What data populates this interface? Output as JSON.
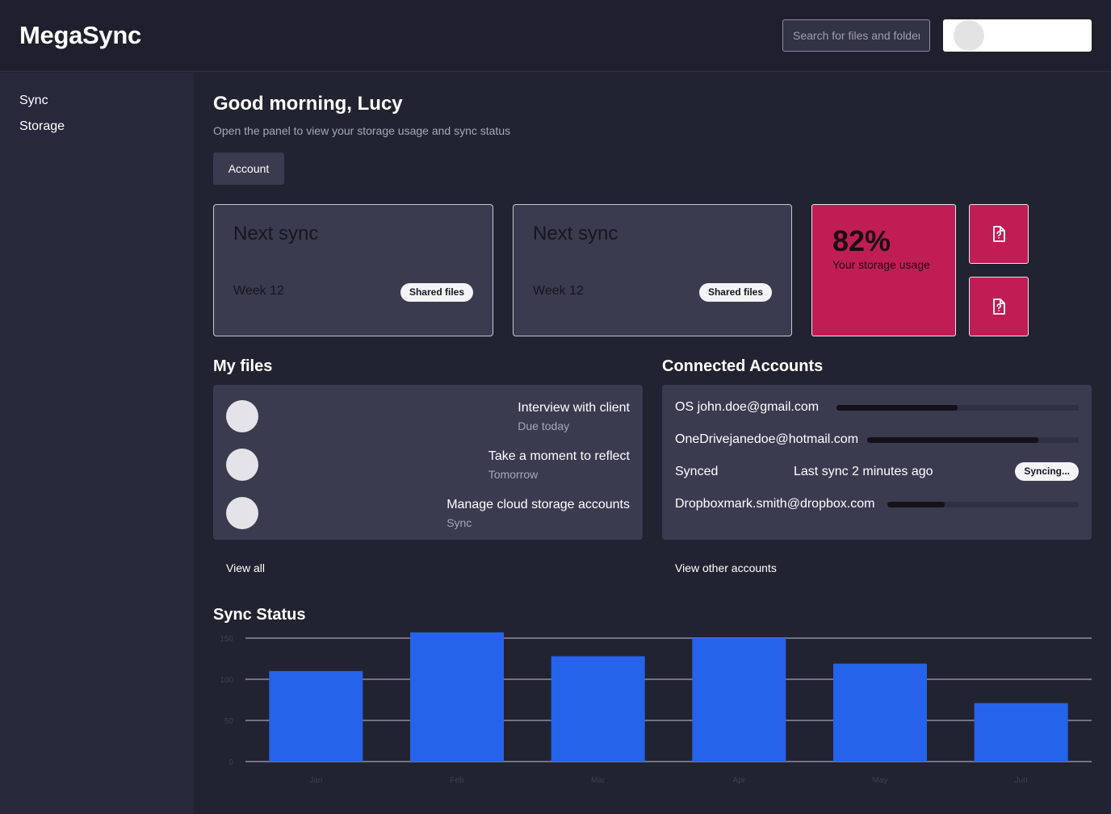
{
  "app": {
    "name": "MegaSync",
    "search_placeholder": "Search for files and folders"
  },
  "sidebar": {
    "items": [
      {
        "label": "Sync"
      },
      {
        "label": "Storage"
      }
    ]
  },
  "main": {
    "greeting": "Good morning, Lucy",
    "subtitle": "Open the panel to view your storage usage and sync status",
    "account_button": "Account"
  },
  "cards": [
    {
      "title": "Next sync",
      "week": "Week 12",
      "badge": "Shared files"
    },
    {
      "title": "Next sync",
      "week": "Week 12",
      "badge": "Shared files"
    }
  ],
  "storage": {
    "percent": "82%",
    "label": "Your storage usage",
    "accent_color": "#c11d55"
  },
  "quick_actions": [
    {
      "icon": "file-question-icon"
    },
    {
      "icon": "file-question-icon"
    }
  ],
  "my_files": {
    "title": "My files",
    "items": [
      {
        "title": "Interview with client",
        "sub": "Due today"
      },
      {
        "title": "Take a moment to reflect",
        "sub": "Tomorrow"
      },
      {
        "title": "Manage cloud storage accounts",
        "sub": "Sync"
      }
    ],
    "view_all": "View all"
  },
  "connected_accounts": {
    "title": "Connected Accounts",
    "rows": [
      {
        "label": "OS  john.doe@gmail.com",
        "progress": 0.5
      },
      {
        "label": "OneDrivejanedoe@hotmail.com",
        "progress": 0.81
      },
      {
        "label": "Synced",
        "status": "Last sync 2 minutes ago",
        "badge": "Syncing..."
      },
      {
        "label": "Dropboxmark.smith@dropbox.com",
        "progress": 0.3
      }
    ],
    "view_other": "View other accounts"
  },
  "sync_status": {
    "title": "Sync Status"
  },
  "chart_data": {
    "type": "bar",
    "categories": [
      "Jan",
      "Feb",
      "Mar",
      "Apr",
      "May",
      "Jun"
    ],
    "values": [
      110,
      157,
      128,
      150,
      119,
      71
    ],
    "ylim": [
      0,
      150
    ],
    "yticks": [
      0,
      50,
      100,
      150
    ],
    "grid": true,
    "bar_color": "#2563eb"
  }
}
